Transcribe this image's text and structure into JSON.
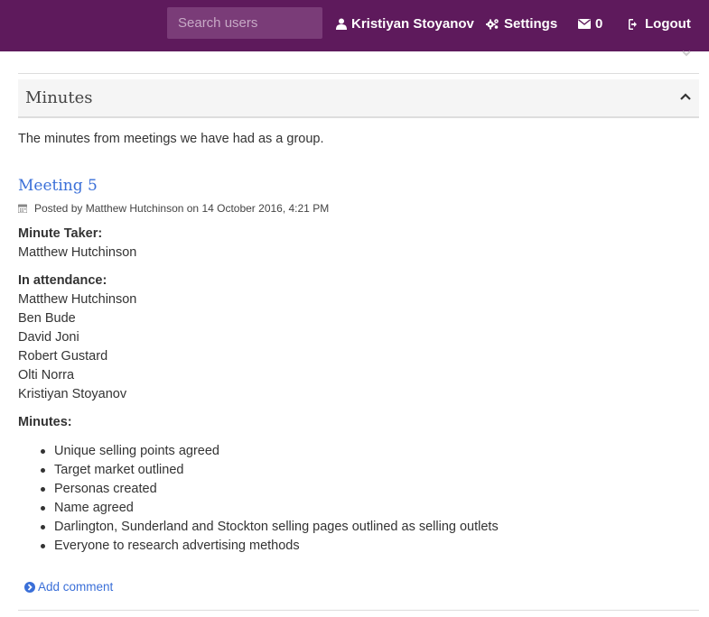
{
  "header": {
    "search_placeholder": "Search users",
    "user_name": "Kristiyan Stoyanov",
    "settings_label": "Settings",
    "messages_count": "0",
    "logout_label": "Logout"
  },
  "panel": {
    "title": "Minutes",
    "intro": "The minutes from meetings we have had as a group."
  },
  "post": {
    "title": "Meeting 5",
    "meta": "Posted by Matthew Hutchinson on 14 October 2016, 4:21 PM",
    "minute_taker_label": "Minute Taker:",
    "minute_taker": "Matthew Hutchinson",
    "attendance_label": "In attendance:",
    "attendees": [
      "Matthew Hutchinson",
      "Ben Bude",
      "David Joni",
      "Robert Gustard",
      "Olti Norra",
      "Kristiyan Stoyanov"
    ],
    "minutes_label": "Minutes:",
    "minutes": [
      "Unique selling points agreed",
      "Target market outlined",
      "Personas created",
      "Name agreed",
      "Darlington, Sunderland and Stockton selling pages outlined as selling outlets",
      "Everyone to research advertising methods"
    ],
    "add_comment_label": "Add comment"
  },
  "colors": {
    "topbar": "#5e1a5c",
    "link": "#3a6fd8"
  }
}
